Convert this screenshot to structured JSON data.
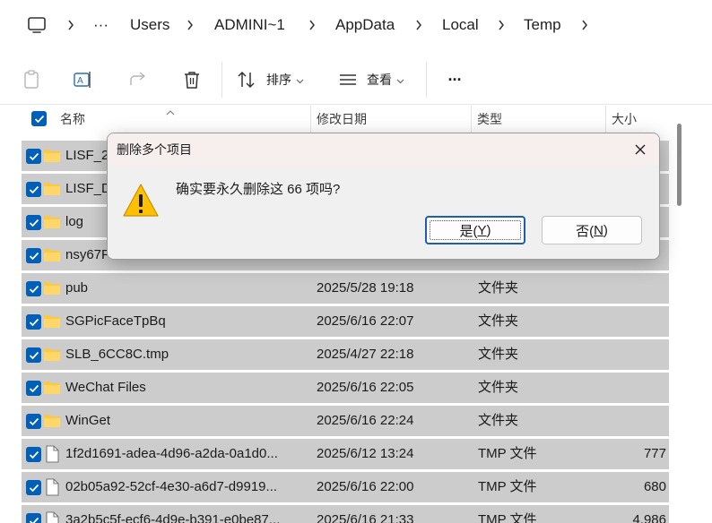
{
  "address_bar": {
    "overflow_label": "···",
    "crumbs": [
      "Users",
      "ADMINI~1",
      "AppData",
      "Local",
      "Temp"
    ]
  },
  "command_bar": {
    "sort_label": "排序",
    "view_label": "查看",
    "more_label": "···"
  },
  "columns": {
    "name": "名称",
    "date": "修改日期",
    "type": "类型",
    "size": "大小"
  },
  "files": [
    {
      "name": "LISF_2",
      "date": "",
      "type": "",
      "size": "",
      "kind": "folder"
    },
    {
      "name": "LISF_D",
      "date": "",
      "type": "",
      "size": "",
      "kind": "folder"
    },
    {
      "name": "log",
      "date": "",
      "type": "",
      "size": "",
      "kind": "folder"
    },
    {
      "name": "nsy67F",
      "date": "",
      "type": "",
      "size": "",
      "kind": "folder"
    },
    {
      "name": "pub",
      "date": "2025/5/28 19:18",
      "type": "文件夹",
      "size": "",
      "kind": "folder"
    },
    {
      "name": "SGPicFaceTpBq",
      "date": "2025/6/16 22:07",
      "type": "文件夹",
      "size": "",
      "kind": "folder"
    },
    {
      "name": "SLB_6CC8C.tmp",
      "date": "2025/4/27 22:18",
      "type": "文件夹",
      "size": "",
      "kind": "folder"
    },
    {
      "name": "WeChat Files",
      "date": "2025/6/16 22:05",
      "type": "文件夹",
      "size": "",
      "kind": "folder"
    },
    {
      "name": "WinGet",
      "date": "2025/6/16 22:24",
      "type": "文件夹",
      "size": "",
      "kind": "folder"
    },
    {
      "name": "1f2d1691-adea-4d96-a2da-0a1d0...",
      "date": "2025/6/12 13:24",
      "type": "TMP 文件",
      "size": "777",
      "kind": "file"
    },
    {
      "name": "02b05a92-52cf-4e30-a6d7-d9919...",
      "date": "2025/6/16 22:00",
      "type": "TMP 文件",
      "size": "680",
      "kind": "file"
    },
    {
      "name": "3a2b5c5f-ecf6-4d9e-b391-e0be87...",
      "date": "2025/6/16 21:33",
      "type": "TMP 文件",
      "size": "4,986",
      "kind": "file"
    }
  ],
  "dialog": {
    "title": "删除多个项目",
    "message": "确实要永久删除这 66 项吗?",
    "yes_text": "是(",
    "yes_key": "Y",
    "yes_close": ")",
    "no_text": "否(",
    "no_key": "N",
    "no_close": ")"
  },
  "colors": {
    "accent": "#005fb8",
    "row_selected": "#cccccc",
    "folder": "#ffc83d",
    "warning": "#ffc000"
  }
}
